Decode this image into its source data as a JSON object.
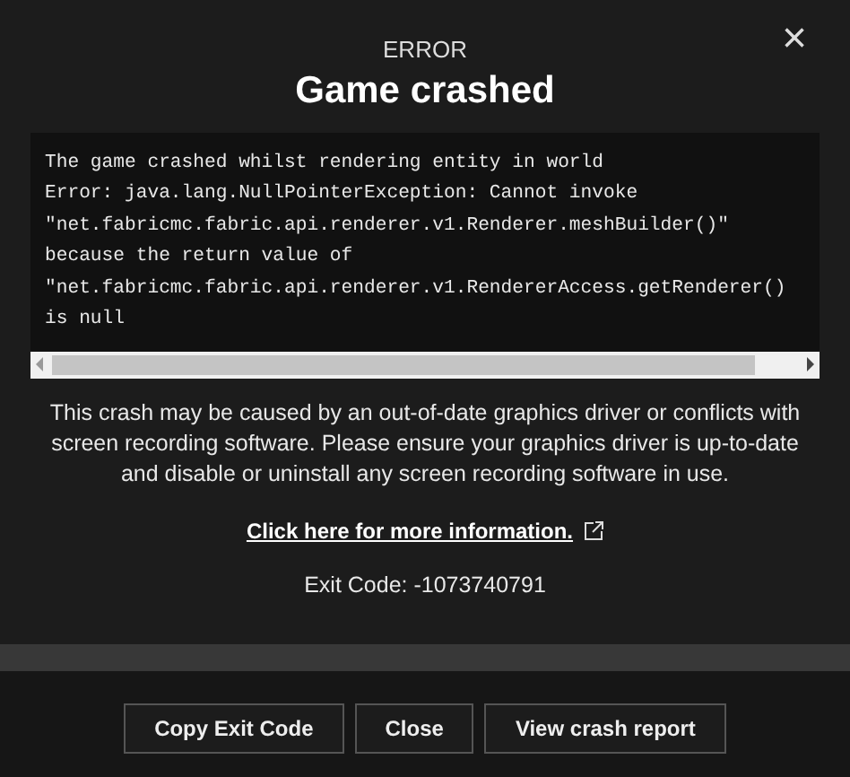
{
  "dialog": {
    "label": "ERROR",
    "title": "Game crashed",
    "close": "×"
  },
  "log": {
    "lines": [
      "The game crashed whilst rendering entity in world",
      "Error: java.lang.NullPointerException: Cannot invoke",
      "\"net.fabricmc.fabric.api.renderer.v1.Renderer.meshBuilder()\"",
      "because the return value of",
      "\"net.fabricmc.fabric.api.renderer.v1.RendererAccess.getRenderer()",
      "is null"
    ]
  },
  "message": "This crash may be caused by an out-of-date graphics driver or conflicts with screen recording software. Please ensure your graphics driver is up-to-date and disable or uninstall any screen recording software in use.",
  "link": "Click here for more information.",
  "exit_code": "Exit Code: -1073740791",
  "buttons": [
    "Copy Exit Code",
    "Close",
    "View crash report"
  ]
}
